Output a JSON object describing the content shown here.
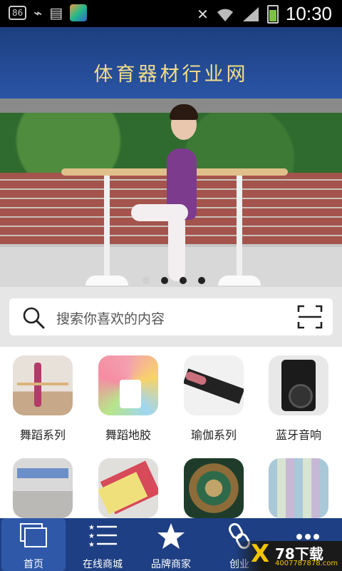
{
  "status_bar": {
    "notification_badge": "86",
    "time": "10:30"
  },
  "header": {
    "title": "体育器材行业网"
  },
  "banner": {
    "slide_count": 4,
    "active_index": 0
  },
  "search": {
    "placeholder": "搜索你喜欢的内容"
  },
  "categories": [
    {
      "label": "舞蹈系列"
    },
    {
      "label": "舞蹈地胶"
    },
    {
      "label": "瑜伽系列"
    },
    {
      "label": "蓝牙音响"
    },
    {
      "label": ""
    },
    {
      "label": ""
    },
    {
      "label": ""
    },
    {
      "label": ""
    }
  ],
  "bottom_nav": [
    {
      "label": "首页",
      "icon": "home-windows-icon",
      "active": true
    },
    {
      "label": "在线商城",
      "icon": "list-icon",
      "active": false
    },
    {
      "label": "品牌商家",
      "icon": "star-icon",
      "active": false
    },
    {
      "label": "创业",
      "icon": "link-icon",
      "active": false
    },
    {
      "label": "",
      "icon": "more-icon",
      "active": false
    }
  ],
  "watermark": {
    "brand": "78下载",
    "url": "4007787878.com"
  },
  "colors": {
    "header_gold": "#f3dd8a",
    "nav_blue": "#1e3f83",
    "accent_yellow": "#f2c400"
  }
}
